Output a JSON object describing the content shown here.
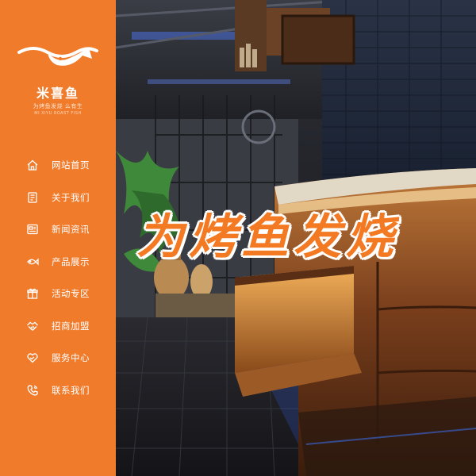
{
  "brand": {
    "name": "米喜鱼",
    "slogan": "为烤鱼发烧 么有生",
    "subline": "MI XIYU ROAST FISH"
  },
  "nav": {
    "items": [
      {
        "label": "网站首页",
        "icon": "home-icon"
      },
      {
        "label": "关于我们",
        "icon": "book-icon"
      },
      {
        "label": "新闻资讯",
        "icon": "news-icon"
      },
      {
        "label": "产品展示",
        "icon": "fish-icon"
      },
      {
        "label": "活动专区",
        "icon": "gift-icon"
      },
      {
        "label": "招商加盟",
        "icon": "handshake-icon"
      },
      {
        "label": "服务中心",
        "icon": "heart-hand-icon"
      },
      {
        "label": "联系我们",
        "icon": "phone-icon"
      }
    ]
  },
  "banner": {
    "headline": "为烤鱼发烧"
  },
  "colors": {
    "sidebar": "#f07b2b",
    "headline": "#f37a22",
    "text": "#ffffff"
  }
}
